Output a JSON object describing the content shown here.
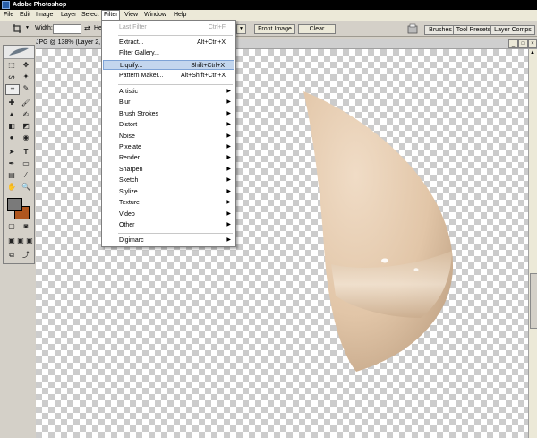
{
  "app": {
    "title": "Adobe Photoshop"
  },
  "menubar": {
    "items": [
      "File",
      "Edit",
      "Image",
      "Layer",
      "Select",
      "Filter",
      "View",
      "Window",
      "Help"
    ],
    "active": "Filter"
  },
  "options": {
    "width_label": "Width:",
    "height_label": "He",
    "front_image": "Front Image",
    "clear": "Clear"
  },
  "palettes": [
    "Brushes",
    "Tool Presets",
    "Layer Comps"
  ],
  "document": {
    "title": "JPG @ 138% (Layer 2, RG"
  },
  "filter_menu": {
    "last_filter": {
      "label": "Last Filter",
      "shortcut": "Ctrl+F"
    },
    "extract": {
      "label": "Extract...",
      "shortcut": "Alt+Ctrl+X"
    },
    "filter_gallery": {
      "label": "Filter Gallery..."
    },
    "liquify": {
      "label": "Liquify...",
      "shortcut": "Shift+Ctrl+X"
    },
    "pattern_maker": {
      "label": "Pattern Maker...",
      "shortcut": "Alt+Shift+Ctrl+X"
    },
    "submenus": [
      "Artistic",
      "Blur",
      "Brush Strokes",
      "Distort",
      "Noise",
      "Pixelate",
      "Render",
      "Sharpen",
      "Sketch",
      "Stylize",
      "Texture",
      "Video",
      "Other"
    ],
    "digimarc": {
      "label": "Digimarc"
    }
  },
  "colors": {
    "foreground": "#7a7a7a",
    "background": "#b0561e",
    "object_light": "#f0dcc6",
    "object_dark": "#b89a7c"
  },
  "icons": [
    "photoshop-logo-icon",
    "arrow-icon",
    "minimize-icon",
    "maximize-icon",
    "close-icon",
    "submenu-arrow-icon"
  ]
}
